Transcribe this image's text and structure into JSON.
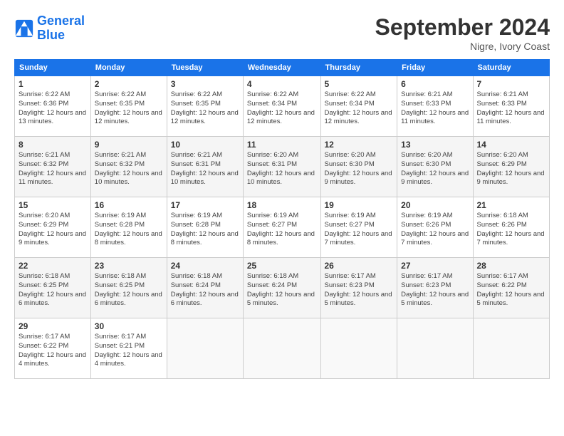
{
  "header": {
    "logo_line1": "General",
    "logo_line2": "Blue",
    "month_title": "September 2024",
    "location": "Nigre, Ivory Coast"
  },
  "days_of_week": [
    "Sunday",
    "Monday",
    "Tuesday",
    "Wednesday",
    "Thursday",
    "Friday",
    "Saturday"
  ],
  "weeks": [
    [
      {
        "day": "1",
        "sunrise": "Sunrise: 6:22 AM",
        "sunset": "Sunset: 6:36 PM",
        "daylight": "Daylight: 12 hours and 13 minutes."
      },
      {
        "day": "2",
        "sunrise": "Sunrise: 6:22 AM",
        "sunset": "Sunset: 6:35 PM",
        "daylight": "Daylight: 12 hours and 12 minutes."
      },
      {
        "day": "3",
        "sunrise": "Sunrise: 6:22 AM",
        "sunset": "Sunset: 6:35 PM",
        "daylight": "Daylight: 12 hours and 12 minutes."
      },
      {
        "day": "4",
        "sunrise": "Sunrise: 6:22 AM",
        "sunset": "Sunset: 6:34 PM",
        "daylight": "Daylight: 12 hours and 12 minutes."
      },
      {
        "day": "5",
        "sunrise": "Sunrise: 6:22 AM",
        "sunset": "Sunset: 6:34 PM",
        "daylight": "Daylight: 12 hours and 12 minutes."
      },
      {
        "day": "6",
        "sunrise": "Sunrise: 6:21 AM",
        "sunset": "Sunset: 6:33 PM",
        "daylight": "Daylight: 12 hours and 11 minutes."
      },
      {
        "day": "7",
        "sunrise": "Sunrise: 6:21 AM",
        "sunset": "Sunset: 6:33 PM",
        "daylight": "Daylight: 12 hours and 11 minutes."
      }
    ],
    [
      {
        "day": "8",
        "sunrise": "Sunrise: 6:21 AM",
        "sunset": "Sunset: 6:32 PM",
        "daylight": "Daylight: 12 hours and 11 minutes."
      },
      {
        "day": "9",
        "sunrise": "Sunrise: 6:21 AM",
        "sunset": "Sunset: 6:32 PM",
        "daylight": "Daylight: 12 hours and 10 minutes."
      },
      {
        "day": "10",
        "sunrise": "Sunrise: 6:21 AM",
        "sunset": "Sunset: 6:31 PM",
        "daylight": "Daylight: 12 hours and 10 minutes."
      },
      {
        "day": "11",
        "sunrise": "Sunrise: 6:20 AM",
        "sunset": "Sunset: 6:31 PM",
        "daylight": "Daylight: 12 hours and 10 minutes."
      },
      {
        "day": "12",
        "sunrise": "Sunrise: 6:20 AM",
        "sunset": "Sunset: 6:30 PM",
        "daylight": "Daylight: 12 hours and 9 minutes."
      },
      {
        "day": "13",
        "sunrise": "Sunrise: 6:20 AM",
        "sunset": "Sunset: 6:30 PM",
        "daylight": "Daylight: 12 hours and 9 minutes."
      },
      {
        "day": "14",
        "sunrise": "Sunrise: 6:20 AM",
        "sunset": "Sunset: 6:29 PM",
        "daylight": "Daylight: 12 hours and 9 minutes."
      }
    ],
    [
      {
        "day": "15",
        "sunrise": "Sunrise: 6:20 AM",
        "sunset": "Sunset: 6:29 PM",
        "daylight": "Daylight: 12 hours and 9 minutes."
      },
      {
        "day": "16",
        "sunrise": "Sunrise: 6:19 AM",
        "sunset": "Sunset: 6:28 PM",
        "daylight": "Daylight: 12 hours and 8 minutes."
      },
      {
        "day": "17",
        "sunrise": "Sunrise: 6:19 AM",
        "sunset": "Sunset: 6:28 PM",
        "daylight": "Daylight: 12 hours and 8 minutes."
      },
      {
        "day": "18",
        "sunrise": "Sunrise: 6:19 AM",
        "sunset": "Sunset: 6:27 PM",
        "daylight": "Daylight: 12 hours and 8 minutes."
      },
      {
        "day": "19",
        "sunrise": "Sunrise: 6:19 AM",
        "sunset": "Sunset: 6:27 PM",
        "daylight": "Daylight: 12 hours and 7 minutes."
      },
      {
        "day": "20",
        "sunrise": "Sunrise: 6:19 AM",
        "sunset": "Sunset: 6:26 PM",
        "daylight": "Daylight: 12 hours and 7 minutes."
      },
      {
        "day": "21",
        "sunrise": "Sunrise: 6:18 AM",
        "sunset": "Sunset: 6:26 PM",
        "daylight": "Daylight: 12 hours and 7 minutes."
      }
    ],
    [
      {
        "day": "22",
        "sunrise": "Sunrise: 6:18 AM",
        "sunset": "Sunset: 6:25 PM",
        "daylight": "Daylight: 12 hours and 6 minutes."
      },
      {
        "day": "23",
        "sunrise": "Sunrise: 6:18 AM",
        "sunset": "Sunset: 6:25 PM",
        "daylight": "Daylight: 12 hours and 6 minutes."
      },
      {
        "day": "24",
        "sunrise": "Sunrise: 6:18 AM",
        "sunset": "Sunset: 6:24 PM",
        "daylight": "Daylight: 12 hours and 6 minutes."
      },
      {
        "day": "25",
        "sunrise": "Sunrise: 6:18 AM",
        "sunset": "Sunset: 6:24 PM",
        "daylight": "Daylight: 12 hours and 5 minutes."
      },
      {
        "day": "26",
        "sunrise": "Sunrise: 6:17 AM",
        "sunset": "Sunset: 6:23 PM",
        "daylight": "Daylight: 12 hours and 5 minutes."
      },
      {
        "day": "27",
        "sunrise": "Sunrise: 6:17 AM",
        "sunset": "Sunset: 6:23 PM",
        "daylight": "Daylight: 12 hours and 5 minutes."
      },
      {
        "day": "28",
        "sunrise": "Sunrise: 6:17 AM",
        "sunset": "Sunset: 6:22 PM",
        "daylight": "Daylight: 12 hours and 5 minutes."
      }
    ],
    [
      {
        "day": "29",
        "sunrise": "Sunrise: 6:17 AM",
        "sunset": "Sunset: 6:22 PM",
        "daylight": "Daylight: 12 hours and 4 minutes."
      },
      {
        "day": "30",
        "sunrise": "Sunrise: 6:17 AM",
        "sunset": "Sunset: 6:21 PM",
        "daylight": "Daylight: 12 hours and 4 minutes."
      },
      null,
      null,
      null,
      null,
      null
    ]
  ]
}
